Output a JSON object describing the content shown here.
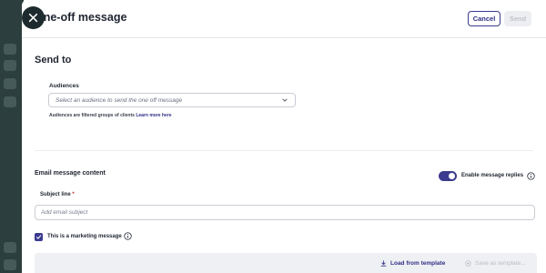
{
  "header": {
    "title": "One-off message",
    "cancel_label": "Cancel",
    "send_label": "Send"
  },
  "send_to": {
    "section_title": "Send to",
    "audiences_label": "Audiences",
    "audiences_placeholder": "Select an audience to send the one off message",
    "help_text": "Audiences are filtered groups of clients",
    "learn_more": "Learn more here"
  },
  "email": {
    "section_title": "Email message content",
    "enable_replies_label": "Enable message replies",
    "enable_replies_on": true,
    "subject_label": "Subject line",
    "subject_required_mark": "*",
    "subject_placeholder": "Add email subject",
    "marketing_label": "This is a marketing message",
    "marketing_checked": true,
    "load_template_label": "Load from template",
    "save_template_label": "Save as template..."
  },
  "colors": {
    "accent": "#3b3b8f",
    "rail": "#2c3e3d"
  }
}
